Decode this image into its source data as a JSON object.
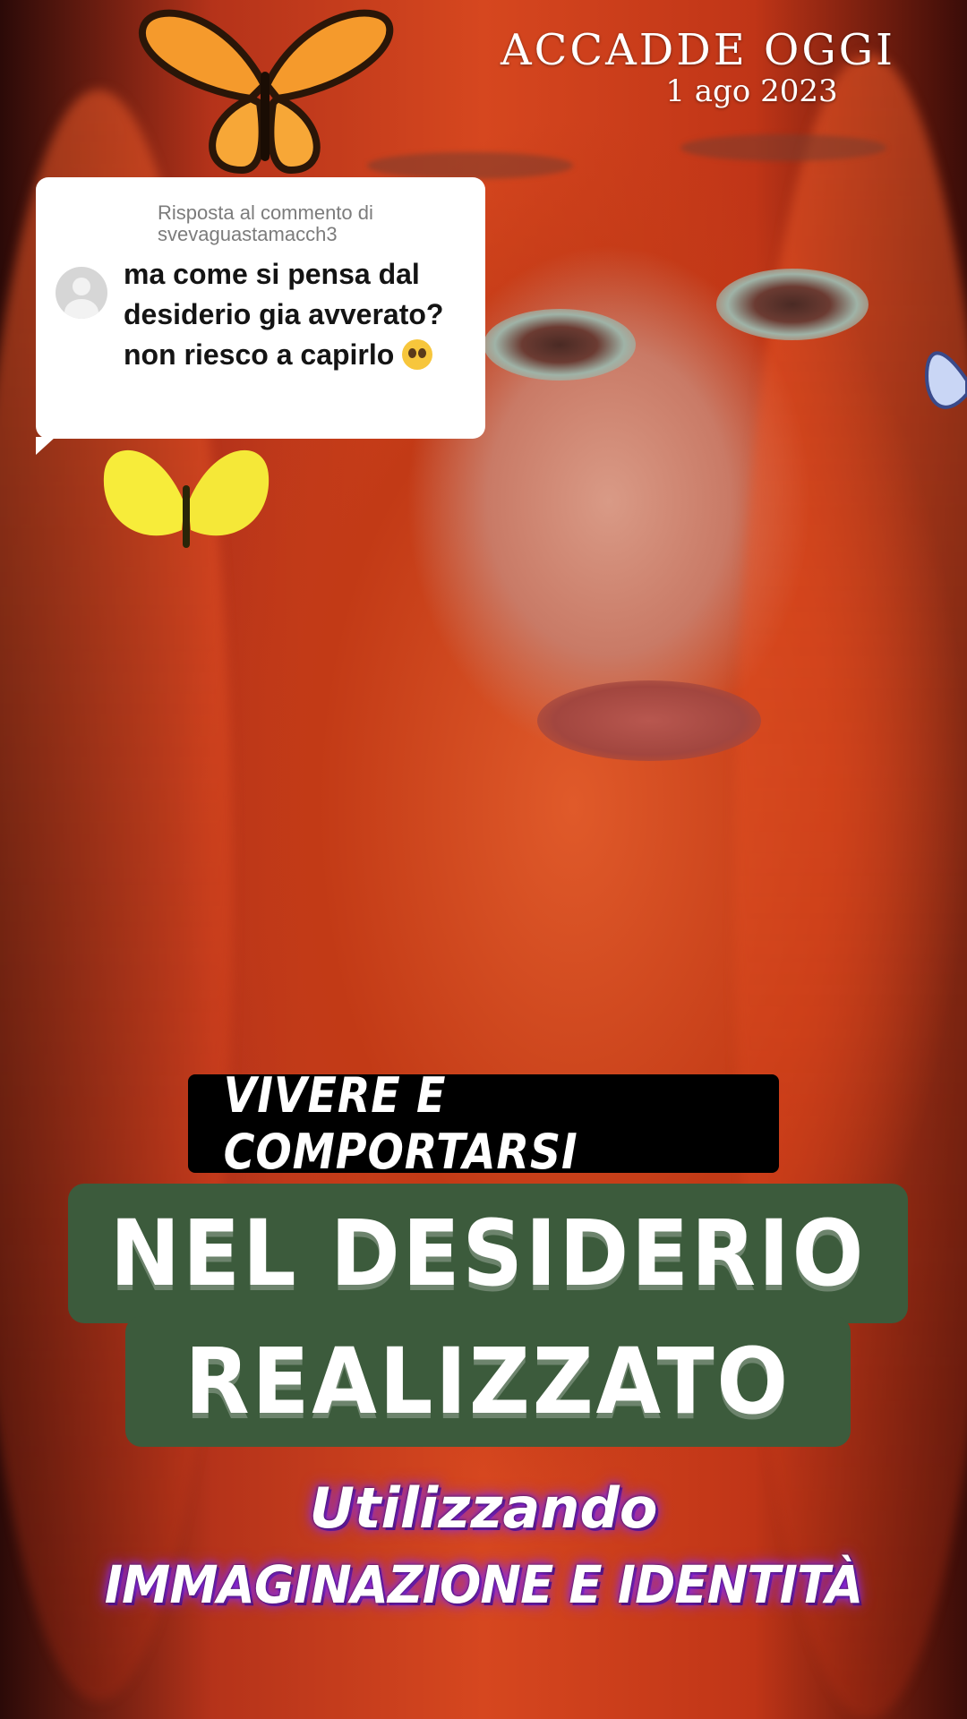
{
  "watermark": {
    "title": "ACCADDE OGGI",
    "date": "1 ago 2023"
  },
  "reply_card": {
    "header_line1": "Risposta al commento di",
    "header_line2": "svevaguastamacch3",
    "comment": "ma come si pensa dal desiderio gia avverato? non riesco a capirlo",
    "emoji": "pleading-face-emoji"
  },
  "captions": {
    "top": "VIVERE E COMPORTARSI",
    "banner_line1": "NEL DESIDERIO",
    "banner_line2": "REALIZZATO",
    "sub_line1": "Utilizzando",
    "sub_line2": "IMMAGINAZIONE E IDENTITÀ"
  },
  "colors": {
    "banner_bg": "#3c5b3c",
    "caption_bg": "#000000",
    "sub_glow": "#8a2be2"
  }
}
